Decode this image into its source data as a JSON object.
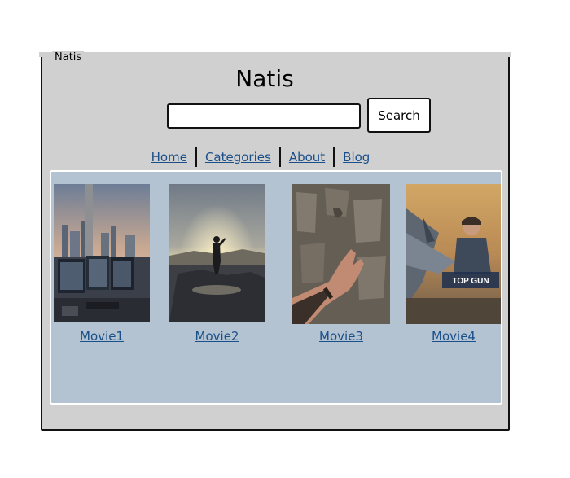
{
  "frame": {
    "label": "Natis"
  },
  "header": {
    "title": "Natis"
  },
  "search": {
    "value": "",
    "placeholder": "",
    "button_label": "Search"
  },
  "nav": {
    "items": [
      {
        "label": "Home"
      },
      {
        "label": "Categories"
      },
      {
        "label": "About"
      },
      {
        "label": "Blog"
      }
    ]
  },
  "movies": [
    {
      "title": "Movie1"
    },
    {
      "title": "Movie2"
    },
    {
      "title": "Movie3"
    },
    {
      "title": "Movie4",
      "poster_text": "TOP GUN"
    }
  ],
  "colors": {
    "frame_bg": "#d0d0d0",
    "gallery_bg": "#b4c3d2",
    "link": "#1a4f8a"
  }
}
